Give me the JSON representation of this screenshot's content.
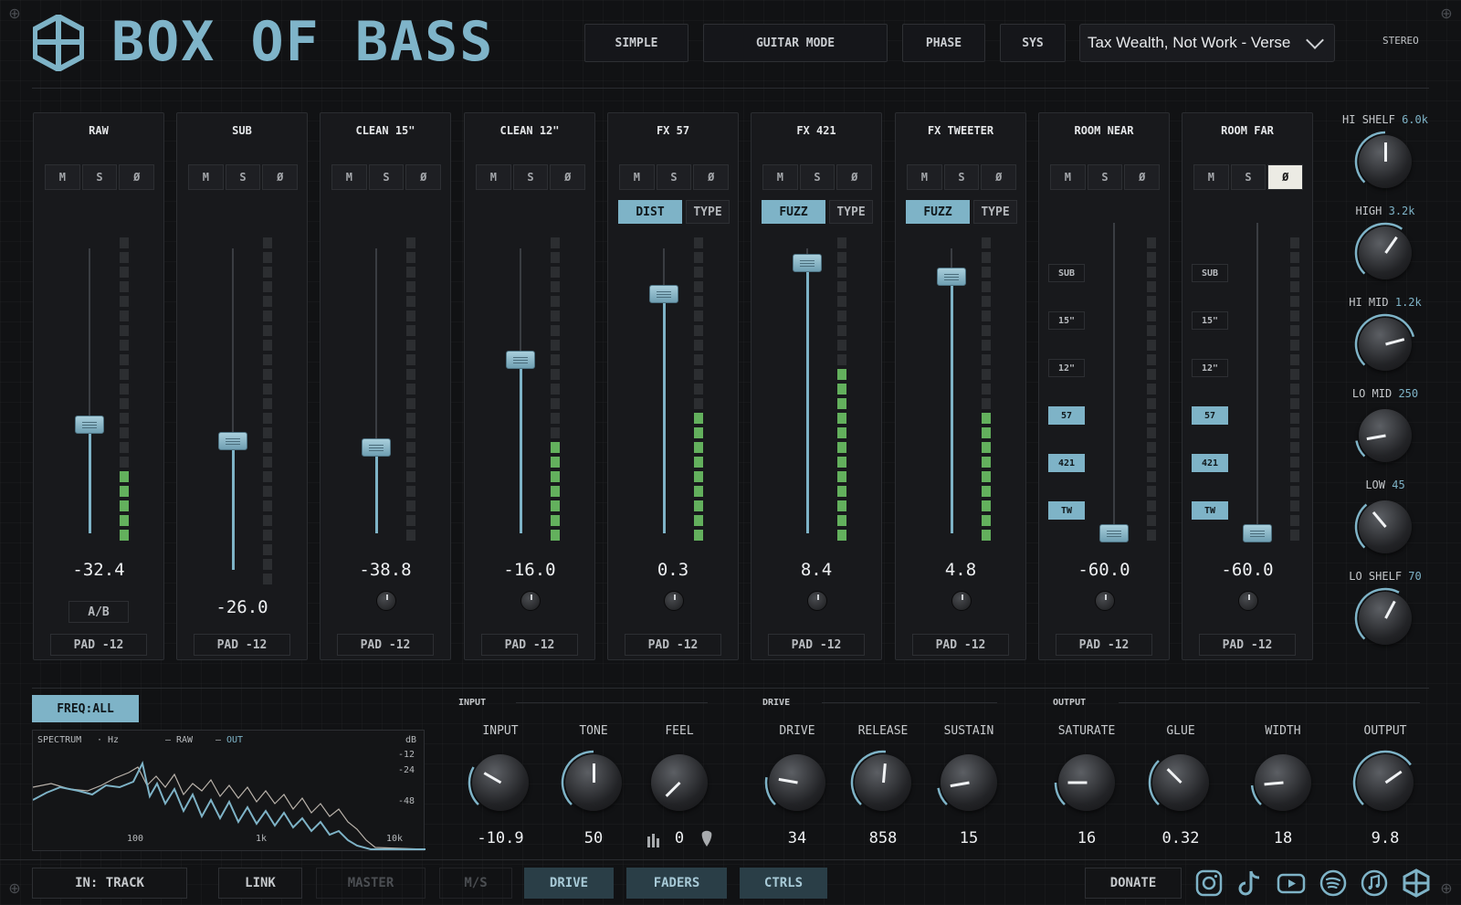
{
  "app": {
    "title": "BOX OF BASS"
  },
  "header": {
    "buttons": [
      "SIMPLE",
      "GUITAR MODE",
      "PHASE",
      "SYS"
    ],
    "preset": "Tax Wealth, Not Work - Verse",
    "stereo": "STEREO"
  },
  "channels": [
    {
      "name": "RAW",
      "value": "-32.4",
      "fader": 0.38,
      "meter": 5,
      "mode": null,
      "ab": "A/B",
      "phase_on": false
    },
    {
      "name": "SUB",
      "value": "-26.0",
      "fader": 0.4,
      "meter": 0,
      "mode": null,
      "phase_on": false
    },
    {
      "name": "CLEAN 15\"",
      "value": "-38.8",
      "fader": 0.3,
      "meter": 0,
      "mode": null,
      "phase_on": false
    },
    {
      "name": "CLEAN 12\"",
      "value": "-16.0",
      "fader": 0.61,
      "meter": 7,
      "mode": null,
      "phase_on": false
    },
    {
      "name": "FX 57",
      "value": "0.3",
      "fader": 0.84,
      "meter": 9,
      "mode": "DIST",
      "type": "TYPE",
      "phase_on": false
    },
    {
      "name": "FX 421",
      "value": "8.4",
      "fader": 0.95,
      "meter": 12,
      "mode": "FUZZ",
      "type": "TYPE",
      "phase_on": false
    },
    {
      "name": "FX TWEETER",
      "value": "4.8",
      "fader": 0.9,
      "meter": 9,
      "mode": "FUZZ",
      "type": "TYPE",
      "phase_on": false
    },
    {
      "name": "ROOM NEAR",
      "value": "-60.0",
      "fader": 0.0,
      "meter": 0,
      "mode": null,
      "room": true,
      "phase_on": false
    },
    {
      "name": "ROOM FAR",
      "value": "-60.0",
      "fader": 0.0,
      "meter": 0,
      "mode": null,
      "room": true,
      "phase_on": true
    }
  ],
  "msp": [
    "M",
    "S",
    "Ø"
  ],
  "pad_label": "PAD -12",
  "room_buttons": [
    {
      "label": "SUB",
      "on": false
    },
    {
      "label": "15\"",
      "on": false
    },
    {
      "label": "12\"",
      "on": false
    },
    {
      "label": "57",
      "on": true
    },
    {
      "label": "421",
      "on": true
    },
    {
      "label": "TW",
      "on": true
    }
  ],
  "eq": [
    {
      "label": "HI SHELF",
      "value": "6.0k",
      "angle": 0
    },
    {
      "label": "HIGH",
      "value": "3.2k",
      "angle": 35
    },
    {
      "label": "HI MID",
      "value": "1.2k",
      "angle": 75
    },
    {
      "label": "LO MID",
      "value": "250",
      "angle": -100
    },
    {
      "label": "LOW",
      "value": "45",
      "angle": -40
    },
    {
      "label": "LO SHELF",
      "value": "70",
      "angle": 28
    }
  ],
  "freq_button": "FREQ:ALL",
  "spectrum": {
    "label": "SPECTRUM",
    "unit": "Hz",
    "raw": "RAW",
    "out": "OUT",
    "db": "dB",
    "db_ticks": [
      "-12",
      "-24",
      "-48"
    ],
    "hz_ticks": [
      "100",
      "1k",
      "10k"
    ]
  },
  "sections": [
    "INPUT",
    "DRIVE",
    "OUTPUT"
  ],
  "bottom_knobs": [
    {
      "label": "INPUT",
      "value": "-10.9",
      "angle": -60
    },
    {
      "label": "TONE",
      "value": "50",
      "angle": 0
    },
    {
      "label": "FEEL",
      "value": "0",
      "angle": -135
    },
    {
      "label": "DRIVE",
      "value": "34",
      "angle": -80
    },
    {
      "label": "RELEASE",
      "value": "858",
      "angle": 5
    },
    {
      "label": "SUSTAIN",
      "value": "15",
      "angle": -100
    },
    {
      "label": "SATURATE",
      "value": "16",
      "angle": -90
    },
    {
      "label": "GLUE",
      "value": "0.32",
      "angle": -45
    },
    {
      "label": "WIDTH",
      "value": "18",
      "angle": -95
    },
    {
      "label": "OUTPUT",
      "value": "9.8",
      "angle": 55
    }
  ],
  "footer": {
    "input": "IN: TRACK",
    "link": "LINK",
    "master": "MASTER",
    "ms": "M/S",
    "drive": "DRIVE",
    "faders": "FADERS",
    "ctrls": "CTRLS",
    "donate": "DONATE"
  },
  "social_icons": [
    "instagram-icon",
    "tiktok-icon",
    "youtube-icon",
    "spotify-icon",
    "apple-music-icon",
    "box-of-bass-icon"
  ],
  "colors": {
    "accent": "#7eb3c7",
    "meter": "#63b05d",
    "background": "#111214"
  }
}
